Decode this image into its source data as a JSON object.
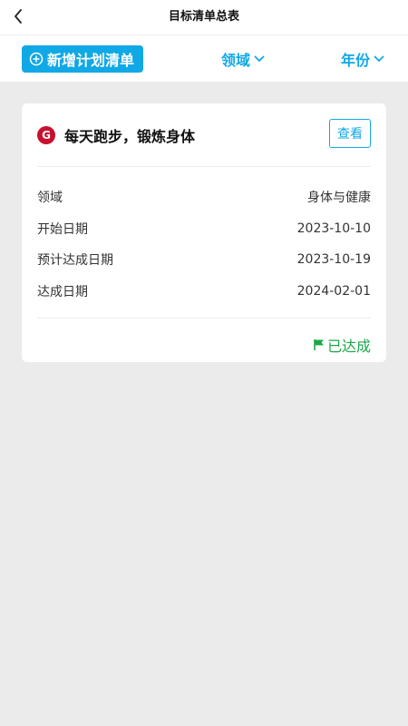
{
  "header": {
    "title": "目标清单总表"
  },
  "toolbar": {
    "add_label": "新增计划清单",
    "filter_domain": "领域",
    "filter_year": "年份"
  },
  "card": {
    "badge": "G",
    "title": "每天跑步，锻炼身体",
    "view_label": "查看",
    "rows": [
      {
        "label": "领域",
        "value": "身体与健康"
      },
      {
        "label": "开始日期",
        "value": "2023-10-10"
      },
      {
        "label": "预计达成日期",
        "value": "2023-10-19"
      },
      {
        "label": "达成日期",
        "value": "2024-02-01"
      }
    ],
    "status": "已达成"
  },
  "colors": {
    "accent": "#11a8e6",
    "success": "#1aa84a",
    "badge": "#c8102e"
  }
}
